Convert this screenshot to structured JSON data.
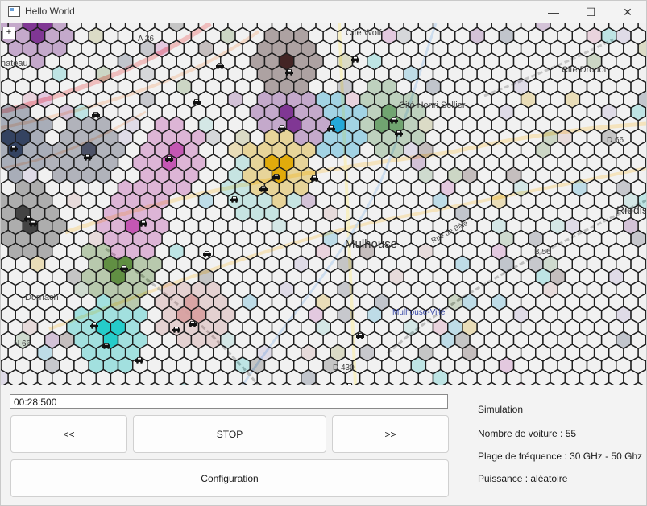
{
  "window": {
    "title": "Hello World"
  },
  "window_controls": {
    "minimize": "—",
    "maximize": "☐",
    "close": "✕"
  },
  "map": {
    "zoom_in": "+",
    "labels": {
      "mulhouse": "Mulhouse",
      "cite_wolf": "Cité Wolf",
      "cite_drouot": "Cité Drouot",
      "cite_henri_sellier": "Cité Henri Sellier",
      "dornach": "Dornach",
      "mulhouse_ville": "Mulhouse-Ville",
      "riedis": "Riedis",
      "chateau": "nateau",
      "a36": "A 36",
      "n66": "N 66",
      "d66": "D 66",
      "b56": "B 56",
      "d430": "D 430",
      "rue_de_bale": "Rue de Bâle"
    },
    "hex_colors": [
      "#3a3a3a",
      "#c24fb0",
      "#5a8a3a",
      "#1aa5d8",
      "#e0a800",
      "#7a2d8f",
      "#2a3a5a",
      "#1acac8",
      "#b0a0d8",
      "#8a8f9a",
      "#3a1a1a",
      "#e07aa8",
      "#6aa06a",
      "#d8a0a0",
      "#80d8d0",
      "#444a60",
      "#9060c0",
      "#a0a040"
    ]
  },
  "timer": {
    "value": "00:28:500"
  },
  "controls": {
    "rewind": "<<",
    "stop": "STOP",
    "forward": ">>",
    "configuration": "Configuration"
  },
  "info": {
    "heading": "Simulation",
    "cars": "Nombre de voiture : 55",
    "frequency": "Plage de fréquence : 30 GHz - 50 Ghz",
    "power": "Puissance : aléatoire"
  }
}
